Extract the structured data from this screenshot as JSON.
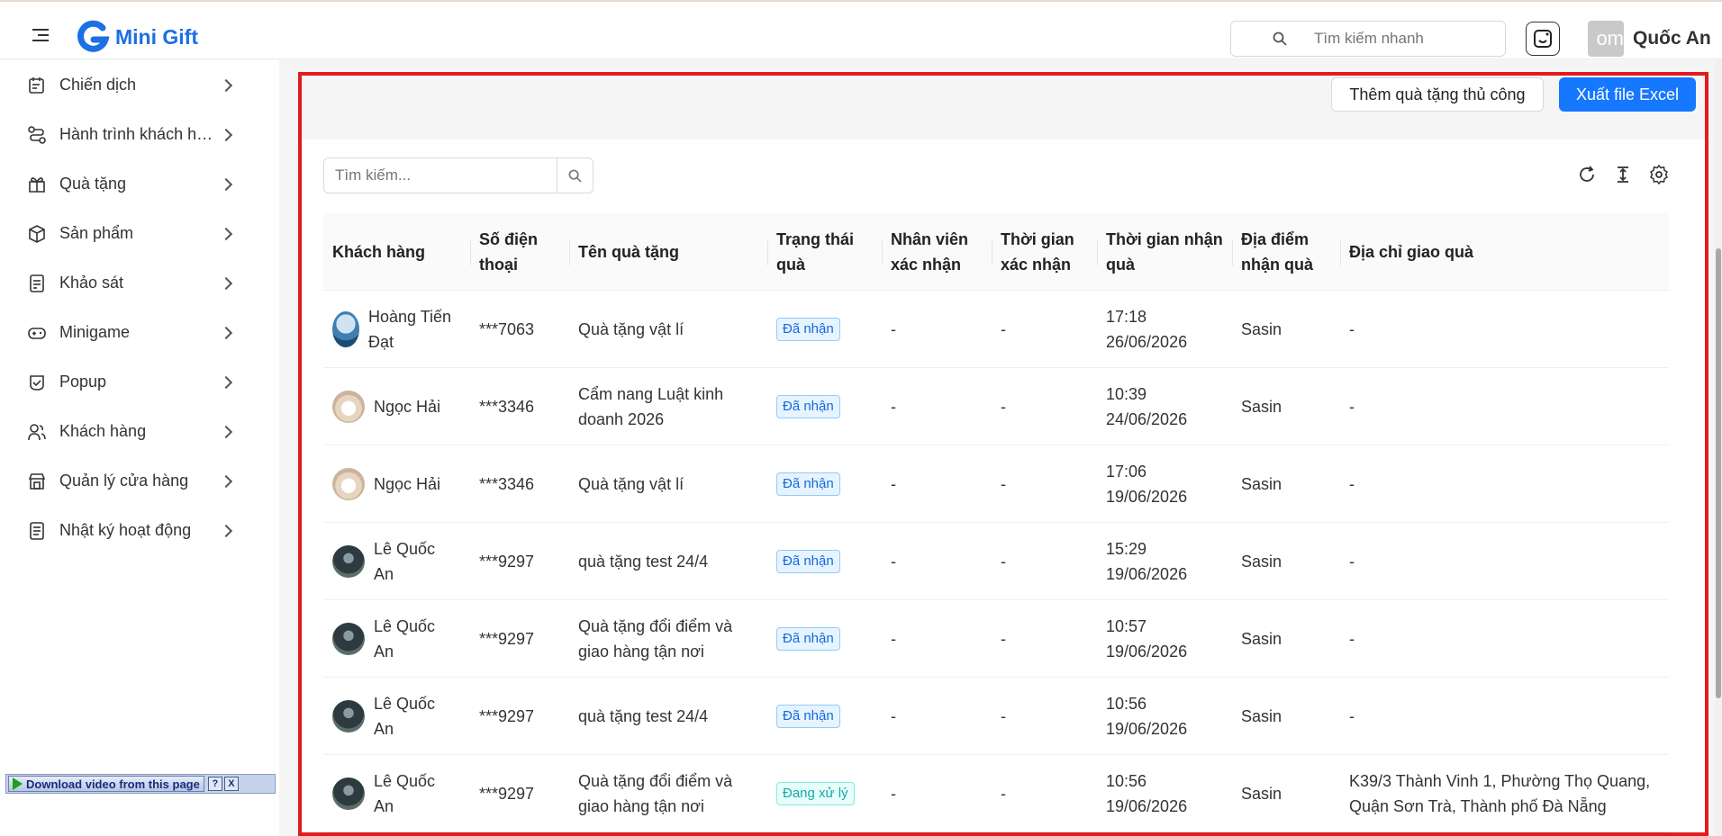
{
  "header": {
    "app_name": "Mini Gift",
    "search_placeholder": "Tìm kiếm nhanh",
    "user_avatar_text": "om",
    "user_name": "Quốc An"
  },
  "sidebar": {
    "items": [
      {
        "label": "Chiến dịch",
        "icon": "calendar-edit-icon"
      },
      {
        "label": "Hành trình khách hàng",
        "icon": "route-icon"
      },
      {
        "label": "Quà tặng",
        "icon": "gift-icon"
      },
      {
        "label": "Sản phẩm",
        "icon": "box-icon"
      },
      {
        "label": "Khảo sát",
        "icon": "survey-icon"
      },
      {
        "label": "Minigame",
        "icon": "gamepad-icon"
      },
      {
        "label": "Popup",
        "icon": "popup-icon"
      },
      {
        "label": "Khách hàng",
        "icon": "users-icon"
      },
      {
        "label": "Quản lý cửa hàng",
        "icon": "store-icon"
      },
      {
        "label": "Nhật ký hoạt động",
        "icon": "log-icon"
      }
    ]
  },
  "download_bar": {
    "label": "Download video from this page",
    "help": "?",
    "close": "X"
  },
  "toolbar": {
    "add_label": "Thêm quà tặng thủ công",
    "export_label": "Xuất file Excel"
  },
  "table": {
    "search_placeholder": "Tìm kiếm...",
    "columns": [
      "Khách hàng",
      "Số điện thoại",
      "Tên quà tặng",
      "Trạng thái quà",
      "Nhân viên xác nhận",
      "Thời gian xác nhận",
      "Thời gian nhận quà",
      "Địa điểm nhận quà",
      "Địa chỉ giao quà"
    ],
    "rows": [
      {
        "customer": "Hoàng Tiến Đạt",
        "phone": "***7063",
        "gift": "Quà tặng vật lí",
        "status": "Đã nhận",
        "staff": "-",
        "confirm_time": "-",
        "receive_time": "17:18 26/06/2026",
        "location": "Sasin",
        "address": "-"
      },
      {
        "customer": "Ngọc Hải",
        "phone": "***3346",
        "gift": "Cẩm nang Luật kinh doanh 2026",
        "status": "Đã nhận",
        "staff": "-",
        "confirm_time": "-",
        "receive_time": "10:39 24/06/2026",
        "location": "Sasin",
        "address": "-"
      },
      {
        "customer": "Ngọc Hải",
        "phone": "***3346",
        "gift": "Quà tặng vật lí",
        "status": "Đã nhận",
        "staff": "-",
        "confirm_time": "-",
        "receive_time": "17:06 19/06/2026",
        "location": "Sasin",
        "address": "-"
      },
      {
        "customer": "Lê Quốc An",
        "phone": "***9297",
        "gift": "quà tặng test 24/4",
        "status": "Đã nhận",
        "staff": "-",
        "confirm_time": "-",
        "receive_time": "15:29 19/06/2026",
        "location": "Sasin",
        "address": "-"
      },
      {
        "customer": "Lê Quốc An",
        "phone": "***9297",
        "gift": "Quà tặng đổi điểm và giao hàng tận nơi",
        "status": "Đã nhận",
        "staff": "-",
        "confirm_time": "-",
        "receive_time": "10:57 19/06/2026",
        "location": "Sasin",
        "address": "-"
      },
      {
        "customer": "Lê Quốc An",
        "phone": "***9297",
        "gift": "quà tặng test 24/4",
        "status": "Đã nhận",
        "staff": "-",
        "confirm_time": "-",
        "receive_time": "10:56 19/06/2026",
        "location": "Sasin",
        "address": "-"
      },
      {
        "customer": "Lê Quốc An",
        "phone": "***9297",
        "gift": "Quà tặng đổi điểm và giao hàng tận nơi",
        "status": "Đang xử lý",
        "staff": "-",
        "confirm_time": "-",
        "receive_time": "10:56 19/06/2026",
        "location": "Sasin",
        "address": "K39/3 Thành Vinh 1, Phường Thọ Quang, Quận Sơn Trà, Thành phố Đà Nẵng"
      }
    ]
  },
  "colors": {
    "primary": "#1677ff",
    "frame_highlight": "#e21b1b",
    "tag_done": "#1668dc",
    "tag_processing": "#13a8a8"
  }
}
